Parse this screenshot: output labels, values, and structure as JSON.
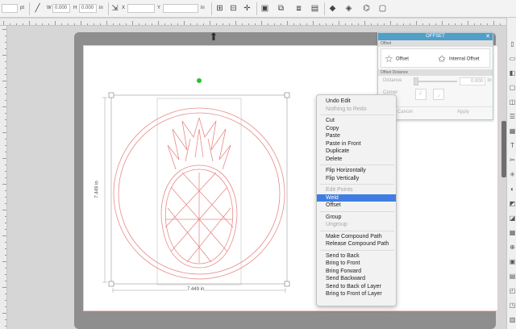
{
  "toolbar": {
    "x_value": "",
    "x_unit": "pt",
    "w_label": "W",
    "w_value": "0.000",
    "h_label": "H",
    "h_value": "0.000",
    "h_unit": "in",
    "angle_label": "X",
    "y_label": "Y",
    "y_unit": "in"
  },
  "canvas": {
    "width_dim": "7.449 in",
    "height_dim": "7.449 in"
  },
  "offset_panel": {
    "title": "OFFSET",
    "section_offset": "Offset",
    "mode_offset": "Offset",
    "mode_internal": "Internal Offset",
    "section_distance": "Offset Distance",
    "distance_label": "Distance",
    "distance_value": "0.000",
    "distance_unit": "in",
    "corner_label": "Corner",
    "cancel_label": "Cancel",
    "apply_label": "Apply"
  },
  "context_menu": {
    "groups": [
      [
        {
          "label": "Undo Edit",
          "disabled": false
        },
        {
          "label": "Nothing to Redo",
          "disabled": true
        }
      ],
      [
        {
          "label": "Cut",
          "disabled": false
        },
        {
          "label": "Copy",
          "disabled": false
        },
        {
          "label": "Paste",
          "disabled": false
        },
        {
          "label": "Paste in Front",
          "disabled": false
        },
        {
          "label": "Duplicate",
          "disabled": false
        },
        {
          "label": "Delete",
          "disabled": false
        }
      ],
      [
        {
          "label": "Flip Horizontally",
          "disabled": false
        },
        {
          "label": "Flip Vertically",
          "disabled": false
        }
      ],
      [
        {
          "label": "Edit Points",
          "disabled": true
        },
        {
          "label": "Weld",
          "disabled": false,
          "highlighted": true
        },
        {
          "label": "Offset",
          "disabled": false
        }
      ],
      [
        {
          "label": "Group",
          "disabled": false
        },
        {
          "label": "Ungroup",
          "disabled": true
        }
      ],
      [
        {
          "label": "Make Compound Path",
          "disabled": false
        },
        {
          "label": "Release Compound Path",
          "disabled": false
        }
      ],
      [
        {
          "label": "Send to Back",
          "disabled": false
        },
        {
          "label": "Bring to Front",
          "disabled": false
        },
        {
          "label": "Bring Forward",
          "disabled": false
        },
        {
          "label": "Send Backward",
          "disabled": false
        },
        {
          "label": "Send to Back of Layer",
          "disabled": false
        },
        {
          "label": "Bring to Front of Layer",
          "disabled": false
        }
      ]
    ]
  },
  "colors": {
    "accent": "#4f9fc8",
    "menu_highlight": "#3f7de2",
    "artwork_stroke": "#e88a8a",
    "rotate_handle": "#2fbf2f"
  }
}
